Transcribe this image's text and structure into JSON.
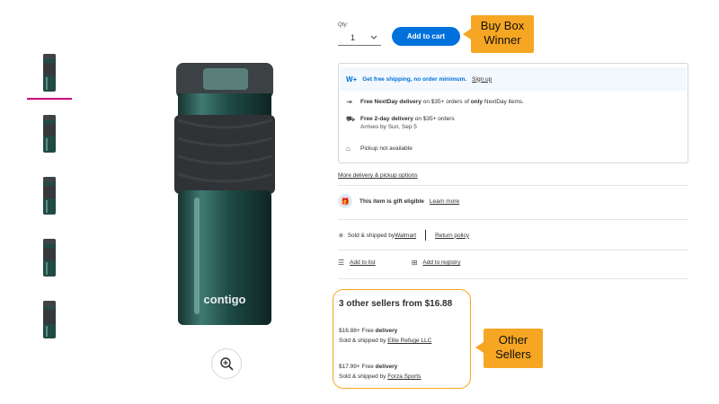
{
  "thumbnails": [
    "thumbnail-1",
    "thumbnail-2",
    "thumbnail-3",
    "thumbnail-4",
    "thumbnail-5"
  ],
  "product_brand_on_image": "contigo",
  "qty": {
    "label": "Qty:",
    "value": "1"
  },
  "add_to_cart": "Add to cart",
  "annotations": {
    "buy_box": "Buy Box Winner",
    "other_sellers": "Other Sellers"
  },
  "fulfillment": {
    "wplus_logo": "W+",
    "wplus_text": "Get free shipping, no order minimum.",
    "wplus_link": "Sign up",
    "nextday_bold": "Free NextDay delivery",
    "nextday_text": " on $35+ orders of ",
    "nextday_only": "only",
    "nextday_tail": " NextDay items.",
    "twoday_bold": "Free 2-day delivery",
    "twoday_text": " on $35+ orders",
    "twoday_arrives": "Arrives by Sun, Sep 5",
    "pickup": "Pickup not available"
  },
  "more_delivery": "More delivery & pickup options",
  "gift": {
    "text": "This item is gift eligible",
    "link": "Learn more"
  },
  "sold_by": {
    "prefix": "Sold & shipped by ",
    "seller": "Walmart",
    "return_policy": "Return policy"
  },
  "list_actions": {
    "add_to_list": "Add to list",
    "add_to_registry": "Add to registry"
  },
  "other_sellers": {
    "title": "3 other sellers from $16.88",
    "offers": [
      {
        "price": "$16.88",
        "free": "+ Free ",
        "delivery": "delivery",
        "sold_prefix": "Sold & shipped by ",
        "seller": "Elite Refuge LLC"
      },
      {
        "price": "$17.99",
        "free": "+ Free ",
        "delivery": "delivery",
        "sold_prefix": "Sold & shipped by ",
        "seller": "Forza Sports"
      }
    ]
  },
  "colors": {
    "accent_blue": "#0071dc",
    "annotation_orange": "#f6a623",
    "selected_thumb": "#c8007a"
  }
}
